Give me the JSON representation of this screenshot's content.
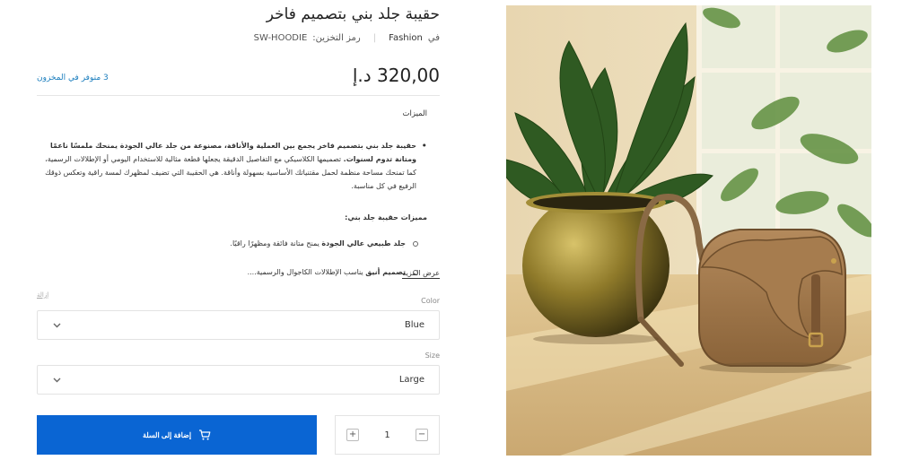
{
  "product": {
    "title": "حقيبة جلد بني بتصميم فاخر",
    "category_label": "في",
    "category": "Fashion",
    "sku_label": "رمز التخزين:",
    "sku": "SW-HOODIE",
    "price": "320,00 د.إ",
    "stock": "3 متوفر في المخزون"
  },
  "description": {
    "heading": "الميزات",
    "intro_bold": "حقيبة جلد بني بتصميم فاخر يجمع بين العملية والأناقة، مصنوعة من جلد عالي الجودة يمنحك ملمسًا ناعمًا ومتانة تدوم لسنوات.",
    "intro_text": "تصميمها الكلاسيكي مع التفاصيل الدقيقة يجعلها قطعة مثالية للاستخدام اليومي أو الإطلالات الرسمية، كما تمنحك مساحة منظمة لحمل مقتنياتك الأساسية بسهولة وأناقة. هي الحقيبة التي تضيف لمظهرك لمسة راقية وتعكس ذوقك الرفيع في كل مناسبة.",
    "features_heading": "مميزات حقيبة جلد بني:",
    "features": [
      {
        "bold": "جلد طبيعي عالي الجودة",
        "text": "يمنح متانة فائقة ومظهرًا راقيًا."
      },
      {
        "bold": "تصميم أنيق",
        "text": "يناسب الإطلالات الكاجوال والرسمية...."
      }
    ],
    "show_more": "عرض المزيد"
  },
  "options": {
    "clear": "إزالة",
    "color_label": "Color",
    "color_value": "Blue",
    "size_label": "Size",
    "size_value": "Large"
  },
  "cart": {
    "quantity": "1",
    "minus": "−",
    "plus": "+",
    "add_label": "إضافة إلى السلة"
  },
  "icons": {
    "chevron": "chevron-down-icon",
    "cart": "cart-icon"
  },
  "colors": {
    "accent": "#0a65d3",
    "stock": "#1a7dbd"
  }
}
